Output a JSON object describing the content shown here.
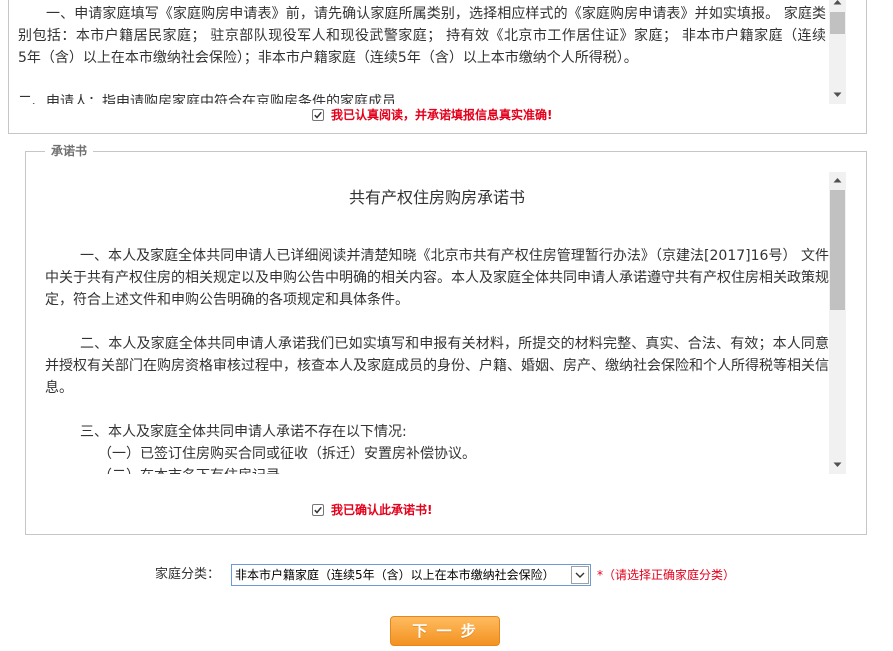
{
  "notice": {
    "paragraphs": [
      [
        "一、申请家庭填写《家庭购房申请表》前，请先确认家庭所属类别，选择相应样式的《家庭购房申请表》并如实填报。 家庭类",
        "别包括：本市户籍居民家庭； 驻京部队现役军人和现役武警家庭； 持有效《北京市工作居住证》家庭； 非本市户籍家庭（连续",
        "5年（含）以上在本市缴纳社会保险）；非本市户籍家庭（连续5年（含）以上本市缴纳个人所得税）。"
      ],
      [
        "二、申请人：指申请购房家庭中符合在京购房条件的家庭成员"
      ]
    ],
    "confirm": {
      "checked": true,
      "label": "我已认真阅读，并承诺填报信息真实准确!"
    }
  },
  "pledge": {
    "legend": "承诺书",
    "title": "共有产权住房购房承诺书",
    "paragraphs": [
      [
        "一、本人及家庭全体共同申请人已详细阅读并清楚知晓《北京市共有产权住房管理暂行办法》（京建法[2017]16号） 文件",
        "中关于共有产权住房的相关规定以及申购公告中明确的相关内容。本人及家庭全体共同申请人承诺遵守共有产权住房相关政策规",
        "定，符合上述文件和申购公告明确的各项规定和具体条件。"
      ],
      [
        "二、本人及家庭全体共同申请人承诺我们已如实填写和申报有关材料，所提交的材料完整、真实、合法、有效；本人同意",
        "并授权有关部门在购房资格审核过程中，核查本人及家庭成员的身份、户籍、婚姻、房产、缴纳社会保险和个人所得税等相关信",
        "息。"
      ],
      [
        "三、本人及家庭全体共同申请人承诺不存在以下情况:",
        "（一）已签订住房购买合同或征收（拆迁）安置房补偿协议。",
        "（二）在本市名下有住房记录。"
      ]
    ],
    "confirm": {
      "checked": true,
      "label": "我已确认此承诺书!"
    }
  },
  "form": {
    "category": {
      "label": "家庭分类：",
      "selected": "非本市户籍家庭（连续5年（含）以上在本市缴纳社会保险）",
      "hint": "*（请选择正确家庭分类）"
    },
    "next_button": {
      "label": "下 一 步"
    }
  },
  "theme": {
    "warning_red": "#e4001b",
    "button_top": "#ffbb5f",
    "button_bottom": "#f39221",
    "button_border": "#e5871d",
    "select_border": "#6c9ad5"
  },
  "icons": {
    "checkbox_mark": "checkmark-icon",
    "dropdown": "chevron-down-icon",
    "scroll_up": "scroll-up-arrow-icon",
    "scroll_down": "scroll-down-arrow-icon"
  }
}
